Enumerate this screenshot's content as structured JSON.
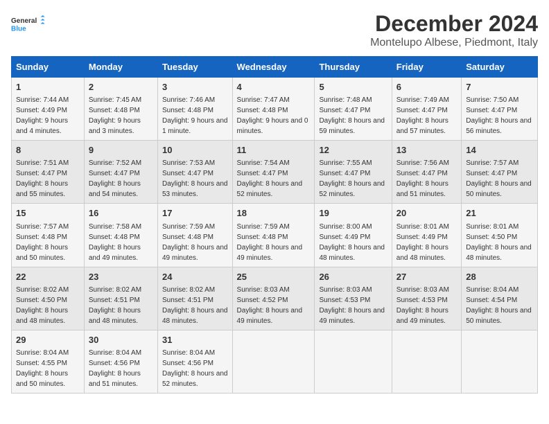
{
  "logo": {
    "line1": "General",
    "line2": "Blue"
  },
  "title": "December 2024",
  "subtitle": "Montelupo Albese, Piedmont, Italy",
  "days_of_week": [
    "Sunday",
    "Monday",
    "Tuesday",
    "Wednesday",
    "Thursday",
    "Friday",
    "Saturday"
  ],
  "weeks": [
    [
      {
        "day": 1,
        "sunrise": "7:44 AM",
        "sunset": "4:49 PM",
        "daylight": "9 hours and 4 minutes."
      },
      {
        "day": 2,
        "sunrise": "7:45 AM",
        "sunset": "4:48 PM",
        "daylight": "9 hours and 3 minutes."
      },
      {
        "day": 3,
        "sunrise": "7:46 AM",
        "sunset": "4:48 PM",
        "daylight": "9 hours and 1 minute."
      },
      {
        "day": 4,
        "sunrise": "7:47 AM",
        "sunset": "4:48 PM",
        "daylight": "9 hours and 0 minutes."
      },
      {
        "day": 5,
        "sunrise": "7:48 AM",
        "sunset": "4:47 PM",
        "daylight": "8 hours and 59 minutes."
      },
      {
        "day": 6,
        "sunrise": "7:49 AM",
        "sunset": "4:47 PM",
        "daylight": "8 hours and 57 minutes."
      },
      {
        "day": 7,
        "sunrise": "7:50 AM",
        "sunset": "4:47 PM",
        "daylight": "8 hours and 56 minutes."
      }
    ],
    [
      {
        "day": 8,
        "sunrise": "7:51 AM",
        "sunset": "4:47 PM",
        "daylight": "8 hours and 55 minutes."
      },
      {
        "day": 9,
        "sunrise": "7:52 AM",
        "sunset": "4:47 PM",
        "daylight": "8 hours and 54 minutes."
      },
      {
        "day": 10,
        "sunrise": "7:53 AM",
        "sunset": "4:47 PM",
        "daylight": "8 hours and 53 minutes."
      },
      {
        "day": 11,
        "sunrise": "7:54 AM",
        "sunset": "4:47 PM",
        "daylight": "8 hours and 52 minutes."
      },
      {
        "day": 12,
        "sunrise": "7:55 AM",
        "sunset": "4:47 PM",
        "daylight": "8 hours and 52 minutes."
      },
      {
        "day": 13,
        "sunrise": "7:56 AM",
        "sunset": "4:47 PM",
        "daylight": "8 hours and 51 minutes."
      },
      {
        "day": 14,
        "sunrise": "7:57 AM",
        "sunset": "4:47 PM",
        "daylight": "8 hours and 50 minutes."
      }
    ],
    [
      {
        "day": 15,
        "sunrise": "7:57 AM",
        "sunset": "4:48 PM",
        "daylight": "8 hours and 50 minutes."
      },
      {
        "day": 16,
        "sunrise": "7:58 AM",
        "sunset": "4:48 PM",
        "daylight": "8 hours and 49 minutes."
      },
      {
        "day": 17,
        "sunrise": "7:59 AM",
        "sunset": "4:48 PM",
        "daylight": "8 hours and 49 minutes."
      },
      {
        "day": 18,
        "sunrise": "7:59 AM",
        "sunset": "4:48 PM",
        "daylight": "8 hours and 49 minutes."
      },
      {
        "day": 19,
        "sunrise": "8:00 AM",
        "sunset": "4:49 PM",
        "daylight": "8 hours and 48 minutes."
      },
      {
        "day": 20,
        "sunrise": "8:01 AM",
        "sunset": "4:49 PM",
        "daylight": "8 hours and 48 minutes."
      },
      {
        "day": 21,
        "sunrise": "8:01 AM",
        "sunset": "4:50 PM",
        "daylight": "8 hours and 48 minutes."
      }
    ],
    [
      {
        "day": 22,
        "sunrise": "8:02 AM",
        "sunset": "4:50 PM",
        "daylight": "8 hours and 48 minutes."
      },
      {
        "day": 23,
        "sunrise": "8:02 AM",
        "sunset": "4:51 PM",
        "daylight": "8 hours and 48 minutes."
      },
      {
        "day": 24,
        "sunrise": "8:02 AM",
        "sunset": "4:51 PM",
        "daylight": "8 hours and 48 minutes."
      },
      {
        "day": 25,
        "sunrise": "8:03 AM",
        "sunset": "4:52 PM",
        "daylight": "8 hours and 49 minutes."
      },
      {
        "day": 26,
        "sunrise": "8:03 AM",
        "sunset": "4:53 PM",
        "daylight": "8 hours and 49 minutes."
      },
      {
        "day": 27,
        "sunrise": "8:03 AM",
        "sunset": "4:53 PM",
        "daylight": "8 hours and 49 minutes."
      },
      {
        "day": 28,
        "sunrise": "8:04 AM",
        "sunset": "4:54 PM",
        "daylight": "8 hours and 50 minutes."
      }
    ],
    [
      {
        "day": 29,
        "sunrise": "8:04 AM",
        "sunset": "4:55 PM",
        "daylight": "8 hours and 50 minutes."
      },
      {
        "day": 30,
        "sunrise": "8:04 AM",
        "sunset": "4:56 PM",
        "daylight": "8 hours and 51 minutes."
      },
      {
        "day": 31,
        "sunrise": "8:04 AM",
        "sunset": "4:56 PM",
        "daylight": "8 hours and 52 minutes."
      },
      null,
      null,
      null,
      null
    ]
  ]
}
